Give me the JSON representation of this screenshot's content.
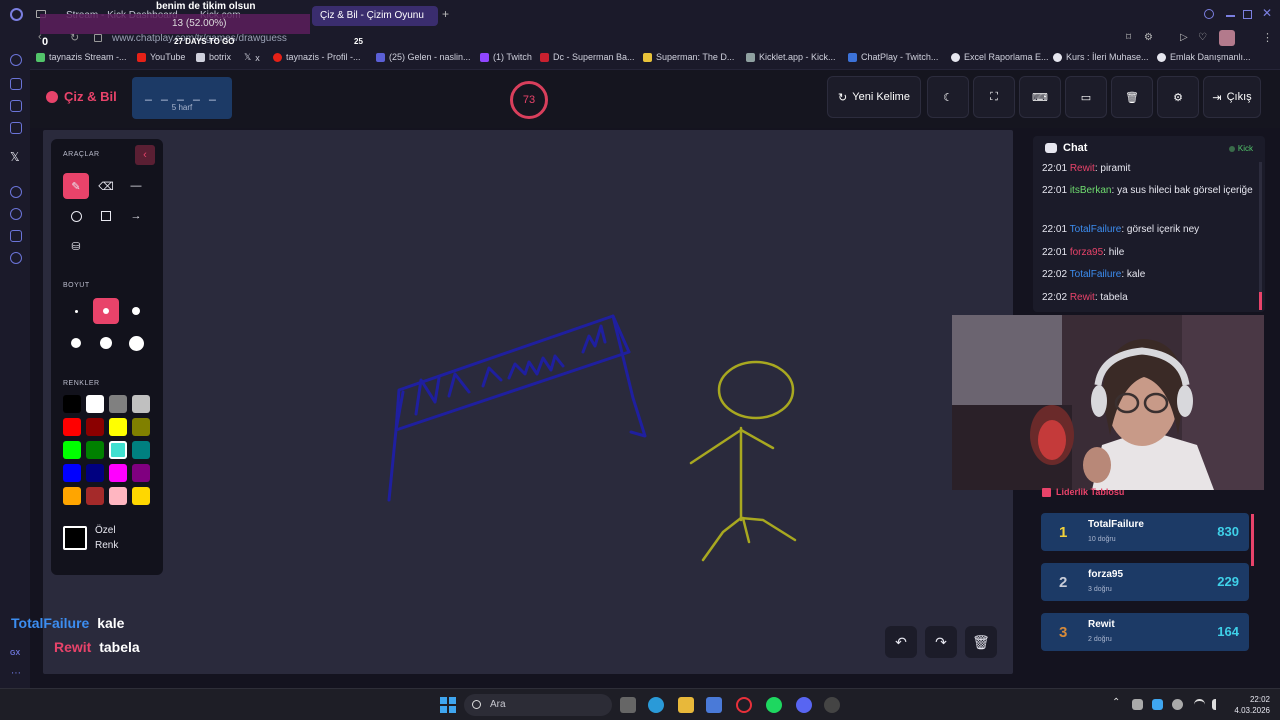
{
  "browser": {
    "tabs": [
      {
        "label": "Stream - Kick Dashboard",
        "active": false
      },
      {
        "label": "Kick.com",
        "active": false
      },
      {
        "label": "Çiz & Bil - Çizim Oyunu",
        "active": true
      }
    ],
    "url": "www.chatplay.com/tr/games/drawguess",
    "bookmarks": [
      {
        "label": "taynazis Stream -...",
        "color": "#52c46a"
      },
      {
        "label": "YouTube",
        "color": "#e62117"
      },
      {
        "label": "botrix",
        "color": "#cfd0dc"
      },
      {
        "label": "x",
        "color": "#cfd0dc"
      },
      {
        "label": "taynazis - Profil -...",
        "color": "#e62117"
      },
      {
        "label": "(25) Gelen - naslin...",
        "color": "#5b5fd6"
      },
      {
        "label": "(1) Twitch",
        "color": "#9146ff"
      },
      {
        "label": "Dc - Superman Ba...",
        "color": "#c8202f"
      },
      {
        "label": "Superman: The D...",
        "color": "#e8c23a"
      },
      {
        "label": "Kicklet.app - Kick...",
        "color": "#8fa0a0"
      },
      {
        "label": "ChatPlay - Twitch...",
        "color": "#3c72d8"
      },
      {
        "label": "Excel Raporlama E...",
        "color": "#e6e6ef"
      },
      {
        "label": "Kurs : İleri Muhase...",
        "color": "#e6e6ef"
      },
      {
        "label": "Emlak Danışmanlı...",
        "color": "#e6e6ef"
      }
    ]
  },
  "stream_overlay": {
    "goal_title": "benim de tikim olsun",
    "goal_progress": "13 (52.00%)",
    "goal_current": "0",
    "goal_days": "27 DAYS TO GO",
    "goal_target": "25",
    "chat_lines": [
      {
        "user": "TotalFailure",
        "text": "kale",
        "color": "#3c8df0"
      },
      {
        "user": "Rewit",
        "text": "tabela",
        "color": "#e8436a"
      }
    ]
  },
  "header": {
    "logo": "Çiz & Bil",
    "word_mask": "_ _ _ _ _",
    "word_length": "5 harf",
    "timer": "73",
    "buttons": {
      "new_word": "Yeni Kelime",
      "exit": "Çıkış"
    }
  },
  "tools": {
    "section_tools": "ARAÇLAR",
    "section_size": "BOYUT",
    "section_colors": "RENKLER",
    "custom_color_line1": "Özel",
    "custom_color_line2": "Renk",
    "colors": [
      "#000000",
      "#ffffff",
      "#808080",
      "#c0c0c0",
      "#ff0000",
      "#8b0000",
      "#ffff00",
      "#808000",
      "#00ff00",
      "#008000",
      "#40e0d0",
      "#008080",
      "#0000ff",
      "#000080",
      "#ff00ff",
      "#800080",
      "#ffa500",
      "#a52a2a",
      "#ffb6c1",
      "#ffd700"
    ],
    "selected_color_index": 10
  },
  "chat": {
    "title": "Chat",
    "platform": "Kick",
    "messages": [
      {
        "time": "22:01",
        "user": "Rewit",
        "user_color": "#e8436a",
        "text": "piramit"
      },
      {
        "time": "22:01",
        "user": "itsBerkan",
        "user_color": "#6fdc6f",
        "text": "ya sus hileci bak görsel içeriğe"
      },
      {
        "time": "22:01",
        "user": "TotalFailure",
        "user_color": "#3c8df0",
        "text": "görsel içerik ney"
      },
      {
        "time": "22:01",
        "user": "forza95",
        "user_color": "#e8436a",
        "text": "hile"
      },
      {
        "time": "22:02",
        "user": "TotalFailure",
        "user_color": "#3c8df0",
        "text": "kale"
      },
      {
        "time": "22:02",
        "user": "Rewit",
        "user_color": "#e8436a",
        "text": "tabela"
      }
    ]
  },
  "leaderboard": {
    "title": "Liderlik Tablosu",
    "rows": [
      {
        "rank": "1",
        "name": "TotalFailure",
        "sub": "10 doğru",
        "score": "830",
        "rank_color": "#f2d23a"
      },
      {
        "rank": "2",
        "name": "forza95",
        "sub": "3 doğru",
        "score": "229",
        "rank_color": "#c8ccd8"
      },
      {
        "rank": "3",
        "name": "Rewit",
        "sub": "2 doğru",
        "score": "164",
        "rank_color": "#d68a3a"
      }
    ]
  },
  "taskbar": {
    "search_placeholder": "Ara",
    "time": "22:02",
    "date": "4.03.2026"
  }
}
